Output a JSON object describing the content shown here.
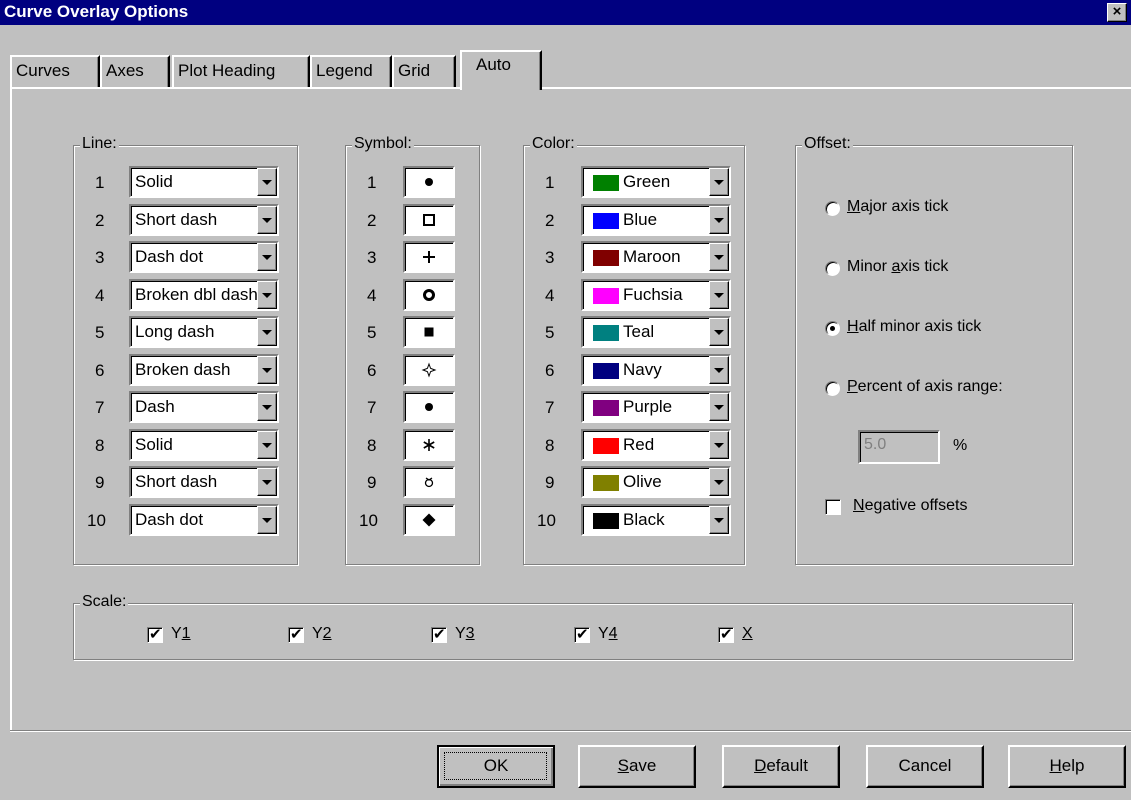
{
  "window": {
    "title": "Curve Overlay Options",
    "close_glyph": "×"
  },
  "tabs": [
    {
      "label": "Curves"
    },
    {
      "label": "Axes"
    },
    {
      "label": "Plot Heading"
    },
    {
      "label": "Legend"
    },
    {
      "label": "Grid"
    },
    {
      "label": "Auto",
      "active": true
    }
  ],
  "line_group": {
    "label": "Line:",
    "items": [
      {
        "num": "1",
        "value": "Solid"
      },
      {
        "num": "2",
        "value": "Short dash"
      },
      {
        "num": "3",
        "value": "Dash dot"
      },
      {
        "num": "4",
        "value": "Broken dbl dash"
      },
      {
        "num": "5",
        "value": "Long dash"
      },
      {
        "num": "6",
        "value": "Broken dash"
      },
      {
        "num": "7",
        "value": "Dash"
      },
      {
        "num": "8",
        "value": "Solid"
      },
      {
        "num": "9",
        "value": "Short dash"
      },
      {
        "num": "10",
        "value": "Dash dot"
      }
    ]
  },
  "symbol_group": {
    "label": "Symbol:",
    "items": [
      {
        "num": "1",
        "symbol": "filled-circle"
      },
      {
        "num": "2",
        "symbol": "open-square"
      },
      {
        "num": "3",
        "symbol": "plus"
      },
      {
        "num": "4",
        "symbol": "open-circle-bold"
      },
      {
        "num": "5",
        "symbol": "filled-square"
      },
      {
        "num": "6",
        "symbol": "open-star"
      },
      {
        "num": "7",
        "symbol": "filled-circle"
      },
      {
        "num": "8",
        "symbol": "asterisk"
      },
      {
        "num": "9",
        "symbol": "small-open-shape"
      },
      {
        "num": "10",
        "symbol": "filled-diamond"
      }
    ]
  },
  "color_group": {
    "label": "Color:",
    "items": [
      {
        "num": "1",
        "name": "Green",
        "hex": "#008000"
      },
      {
        "num": "2",
        "name": "Blue",
        "hex": "#0000ff"
      },
      {
        "num": "3",
        "name": "Maroon",
        "hex": "#800000"
      },
      {
        "num": "4",
        "name": "Fuchsia",
        "hex": "#ff00ff"
      },
      {
        "num": "5",
        "name": "Teal",
        "hex": "#008080"
      },
      {
        "num": "6",
        "name": "Navy",
        "hex": "#000080"
      },
      {
        "num": "7",
        "name": "Purple",
        "hex": "#800080"
      },
      {
        "num": "8",
        "name": "Red",
        "hex": "#ff0000"
      },
      {
        "num": "9",
        "name": "Olive",
        "hex": "#808000"
      },
      {
        "num": "10",
        "name": "Black",
        "hex": "#000000"
      }
    ]
  },
  "offset_group": {
    "label": "Offset:",
    "options": [
      {
        "pre": "",
        "key": "M",
        "post": "ajor axis tick",
        "checked": false
      },
      {
        "pre": "Minor ",
        "key": "a",
        "post": "xis tick",
        "checked": false
      },
      {
        "pre": "",
        "key": "H",
        "post": "alf minor axis tick",
        "checked": true
      },
      {
        "pre": "",
        "key": "P",
        "post": "ercent of axis range:",
        "checked": false
      }
    ],
    "percent_value": "5.0",
    "percent_unit": "%",
    "negative": {
      "pre": "",
      "key": "N",
      "post": "egative offsets",
      "checked": false
    }
  },
  "scale_group": {
    "label": "Scale:",
    "items": [
      {
        "pre": "Y",
        "key": "1",
        "checked": true
      },
      {
        "pre": "Y",
        "key": "2",
        "checked": true
      },
      {
        "pre": "Y",
        "key": "3",
        "checked": true
      },
      {
        "pre": "Y",
        "key": "4",
        "checked": true
      },
      {
        "pre": "",
        "key": "X",
        "checked": true
      }
    ]
  },
  "buttons": [
    {
      "pre": "",
      "key": "",
      "post": "OK",
      "default": true
    },
    {
      "pre": "",
      "key": "S",
      "post": "ave"
    },
    {
      "pre": "",
      "key": "D",
      "post": "efault"
    },
    {
      "pre": "Cancel",
      "key": "",
      "post": ""
    },
    {
      "pre": "",
      "key": "H",
      "post": "elp"
    }
  ]
}
